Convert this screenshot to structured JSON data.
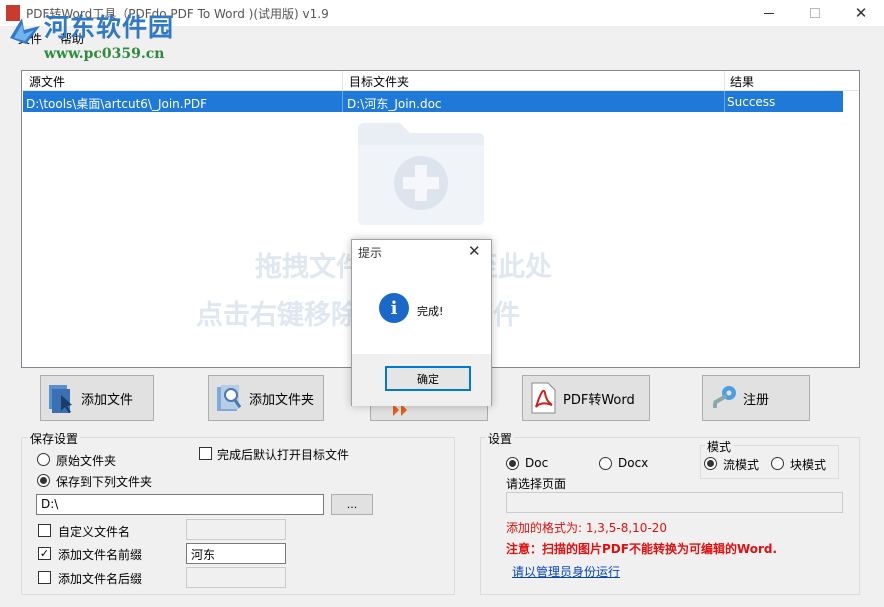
{
  "window": {
    "title": "PDF转Word工具（PDFdo PDF To Word )(试用版) v1.9",
    "minimize": "—",
    "close": "✕"
  },
  "watermark": {
    "site_name": "河东软件园",
    "url": "www.pc0359.cn"
  },
  "menu": {
    "items": [
      "文件",
      "帮助"
    ]
  },
  "file_list": {
    "columns": [
      "源文件",
      "目标文件夹",
      "结果"
    ],
    "rows": [
      {
        "source": "D:\\tools\\桌面\\artcut6\\_Join.PDF",
        "target": "D:\\河东_Join.doc",
        "result": "Success"
      }
    ],
    "drop_hint_line1": "拖拽文件或文件夹至此处",
    "drop_hint_line2": "点击右键移除或添加的文件"
  },
  "dialog": {
    "title": "提示",
    "close": "✕",
    "icon_glyph": "i",
    "message": "完成!",
    "ok_label": "确定"
  },
  "toolbar": {
    "add_file": "添加文件",
    "add_folder": "添加文件夹",
    "pdf_to_word": "PDF转Word",
    "register": "注册"
  },
  "save_settings": {
    "title": "保存设置",
    "original_folder": "原始文件夹",
    "save_to_folder": "保存到下列文件夹",
    "open_after": "完成后默认打开目标文件",
    "folder_path": "D:\\",
    "browse": "...",
    "custom_name": "自定义文件名",
    "add_prefix": "添加文件名前缀",
    "prefix_value": "河东",
    "add_suffix": "添加文件名后缀",
    "selected_option": "save_to_folder",
    "add_prefix_checked": true,
    "custom_name_checked": false,
    "add_suffix_checked": false,
    "open_after_checked": false
  },
  "settings": {
    "title": "设置",
    "doc": "Doc",
    "docx": "Docx",
    "format_selected": "Doc",
    "mode_title": "模式",
    "flow_mode": "流模式",
    "block_mode": "块模式",
    "mode_selected": "流模式",
    "pages_label": "请选择页面",
    "pages_value": "",
    "format_hint": "添加的格式为:  1,3,5-8,10-20",
    "warning": "注意：扫描的图片PDF不能转换为可编辑的Word.",
    "admin_link": "请以管理员身份运行"
  },
  "colors": {
    "selection": "#1f79d8",
    "accent": "#0078d7",
    "warning_red": "#e01010",
    "watermark_blue": "#2f79c6",
    "watermark_green": "#2e8b3c"
  }
}
